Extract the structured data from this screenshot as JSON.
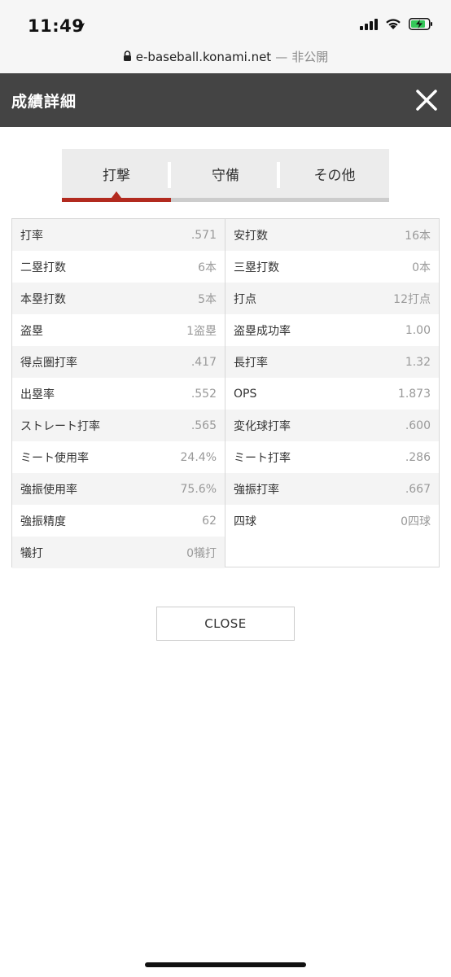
{
  "status_bar": {
    "time": "11:49"
  },
  "url_bar": {
    "domain": "e-baseball.konami.net",
    "separator": "—",
    "privacy": "非公開"
  },
  "header": {
    "title": "成績詳細"
  },
  "tabs": [
    {
      "label": "打撃",
      "active": true
    },
    {
      "label": "守備",
      "active": false
    },
    {
      "label": "その他",
      "active": false
    }
  ],
  "accent_color": "#b22a1f",
  "stats_left": [
    {
      "label": "打率",
      "value": ".571"
    },
    {
      "label": "二塁打数",
      "value": "6本"
    },
    {
      "label": "本塁打数",
      "value": "5本"
    },
    {
      "label": "盗塁",
      "value": "1盗塁"
    },
    {
      "label": "得点圏打率",
      "value": ".417"
    },
    {
      "label": "出塁率",
      "value": ".552"
    },
    {
      "label": "ストレート打率",
      "value": ".565"
    },
    {
      "label": "ミート使用率",
      "value": "24.4%"
    },
    {
      "label": "強振使用率",
      "value": "75.6%"
    },
    {
      "label": "強振精度",
      "value": "62"
    },
    {
      "label": "犠打",
      "value": "0犠打"
    }
  ],
  "stats_right": [
    {
      "label": "安打数",
      "value": "16本"
    },
    {
      "label": "三塁打数",
      "value": "0本"
    },
    {
      "label": "打点",
      "value": "12打点"
    },
    {
      "label": "盗塁成功率",
      "value": "1.00"
    },
    {
      "label": "長打率",
      "value": "1.32"
    },
    {
      "label": "OPS",
      "value": "1.873"
    },
    {
      "label": "変化球打率",
      "value": ".600"
    },
    {
      "label": "ミート打率",
      "value": ".286"
    },
    {
      "label": "強振打率",
      "value": ".667"
    },
    {
      "label": "四球",
      "value": "0四球"
    }
  ],
  "close_button": {
    "label": "CLOSE"
  }
}
